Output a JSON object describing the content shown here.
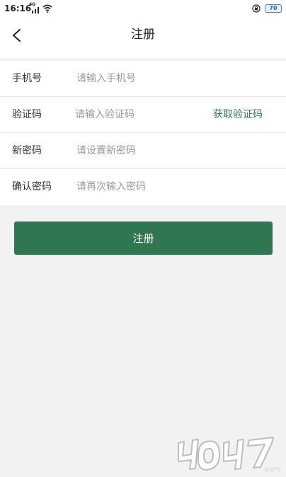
{
  "status_bar": {
    "time": "16:16",
    "network": "4G",
    "battery": "70",
    "icons": [
      "signal-icon",
      "wifi-icon",
      "rotate-lock-icon",
      "battery-icon"
    ]
  },
  "nav": {
    "title": "注册",
    "back_icon": "chevron-left-icon"
  },
  "form": {
    "phone": {
      "label": "手机号",
      "placeholder": "请输入手机号"
    },
    "code": {
      "label": "验证码",
      "placeholder": "请输入验证码",
      "action": "获取验证码"
    },
    "password": {
      "label": "新密码",
      "placeholder": "请设置新密码"
    },
    "confirm": {
      "label": "确认密码",
      "placeholder": "请再次输入密码"
    }
  },
  "submit_label": "注册",
  "colors": {
    "accent": "#307650",
    "link": "#2f7a52",
    "background": "#f2f2f2"
  },
  "watermark": {
    "text": "4399.com"
  }
}
